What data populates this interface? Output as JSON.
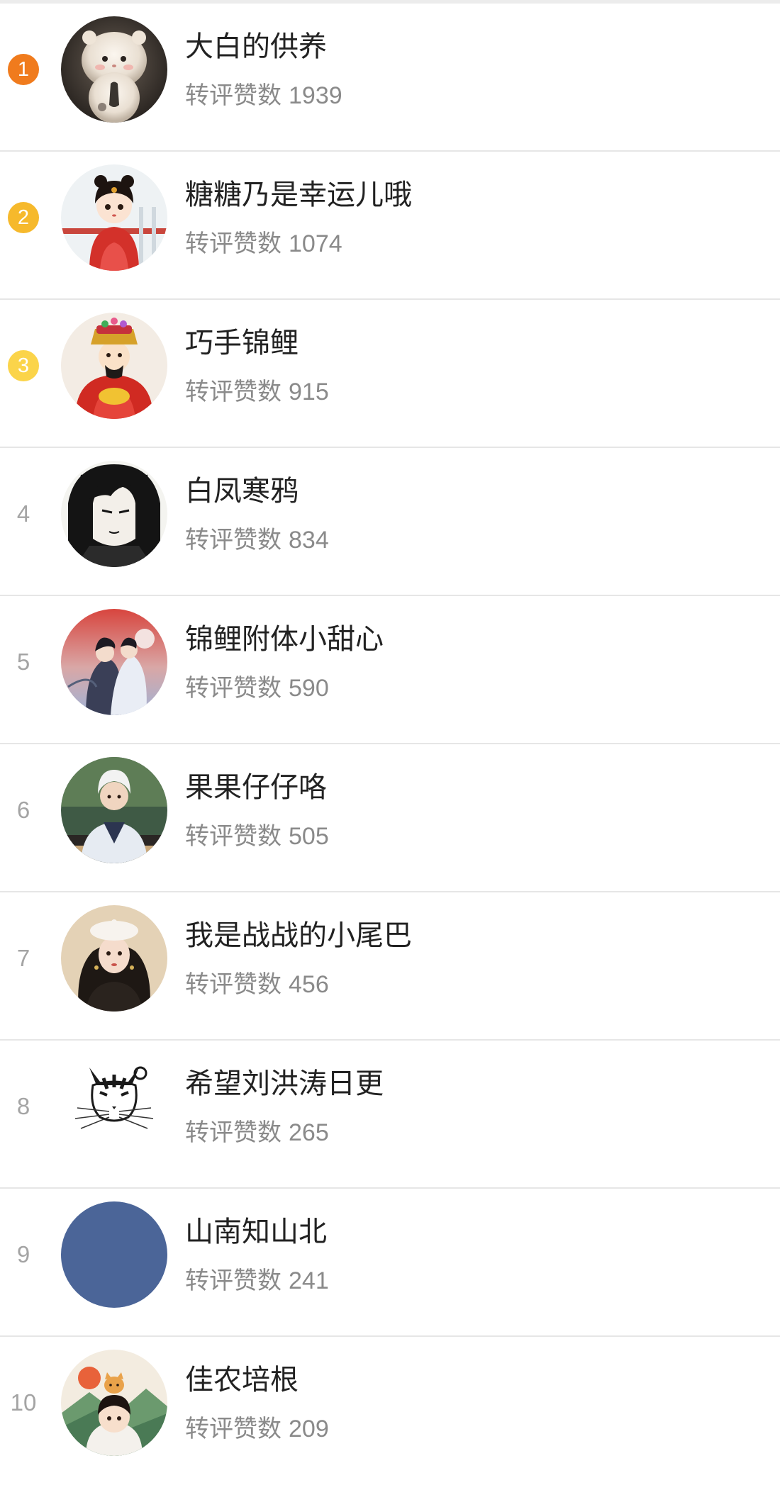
{
  "colors": {
    "rank_1": "#f07b1d",
    "rank_2": "#f6b92c",
    "rank_3": "#fbd44a",
    "rank_plain_text": "#a4a4a4",
    "name_text": "#222222",
    "stats_text": "#8a8a8a",
    "divider": "#e6e6e6"
  },
  "stats_label": "转评赞数",
  "rows": [
    {
      "rank": "1",
      "name": "大白的供养",
      "count": "1939",
      "avatar": "fluffy-hamster-avatar"
    },
    {
      "rank": "2",
      "name": "糖糖乃是幸运儿哦",
      "count": "1074",
      "avatar": "chinese-girl-red-dress-avatar"
    },
    {
      "rank": "3",
      "name": "巧手锦鲤",
      "count": "915",
      "avatar": "god-of-wealth-avatar"
    },
    {
      "rank": "4",
      "name": "白凤寒鸦",
      "count": "834",
      "avatar": "ink-anime-man-avatar"
    },
    {
      "rank": "5",
      "name": "锦鲤附体小甜心",
      "count": "590",
      "avatar": "ancient-couple-avatar"
    },
    {
      "rank": "6",
      "name": "果果仔仔咯",
      "count": "505",
      "avatar": "white-haired-man-avatar"
    },
    {
      "rank": "7",
      "name": "我是战战的小尾巴",
      "count": "456",
      "avatar": "girl-white-beret-avatar"
    },
    {
      "rank": "8",
      "name": "希望刘洪涛日更",
      "count": "265",
      "avatar": "sketch-cat-avatar"
    },
    {
      "rank": "9",
      "name": "山南知山北",
      "count": "241",
      "avatar": "blue-circle-avatar"
    },
    {
      "rank": "10",
      "name": "佳农培根",
      "count": "209",
      "avatar": "cartoon-girl-cat-avatar"
    }
  ]
}
